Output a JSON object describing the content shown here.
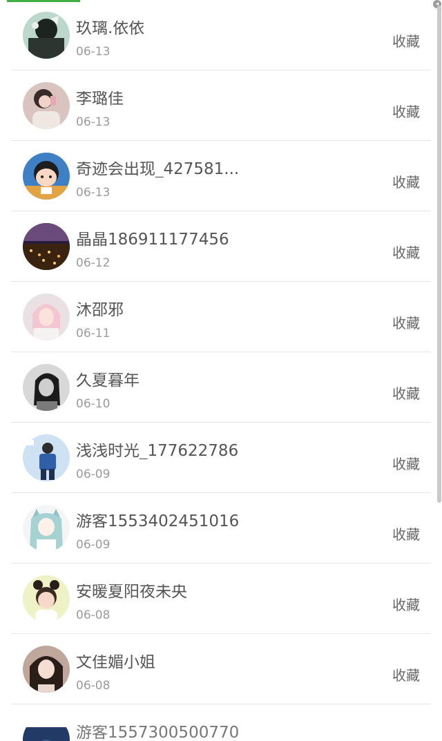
{
  "favorite_label": "收藏",
  "items": [
    {
      "name": "玖璃.依依",
      "date": "06-13",
      "avatar": "avatar-a"
    },
    {
      "name": "李璐佳",
      "date": "06-13",
      "avatar": "avatar-b"
    },
    {
      "name": "奇迹会出现_427581...",
      "date": "06-13",
      "avatar": "avatar-c"
    },
    {
      "name": "晶晶186911177456",
      "date": "06-12",
      "avatar": "avatar-d"
    },
    {
      "name": "沐邵邪",
      "date": "06-11",
      "avatar": "avatar-e"
    },
    {
      "name": "久夏暮年",
      "date": "06-10",
      "avatar": "avatar-f"
    },
    {
      "name": "浅浅时光_177622786",
      "date": "06-09",
      "avatar": "avatar-g"
    },
    {
      "name": "游客1553402451016",
      "date": "06-09",
      "avatar": "avatar-h"
    },
    {
      "name": "安暖夏阳夜未央",
      "date": "06-08",
      "avatar": "avatar-i"
    },
    {
      "name": "文佳媚小姐",
      "date": "06-08",
      "avatar": "avatar-j"
    }
  ],
  "partial_item": {
    "name": "游客1557300500770"
  }
}
